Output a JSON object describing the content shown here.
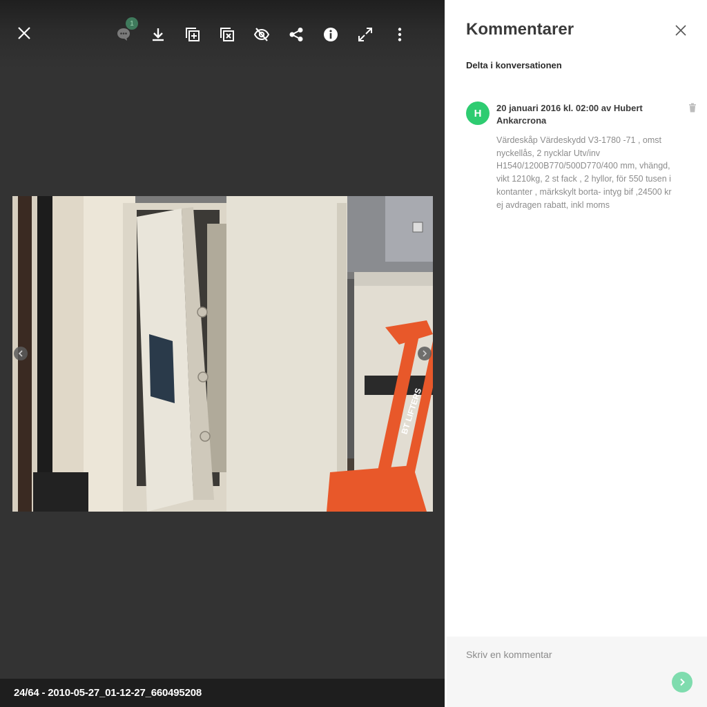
{
  "toolbar": {
    "comment_count": "1",
    "icons": [
      "close-icon",
      "comment-icon",
      "download-icon",
      "add-to-album-icon",
      "remove-from-album-icon",
      "hide-icon",
      "share-icon",
      "info-icon",
      "fullscreen-icon",
      "more-icon"
    ]
  },
  "caption": "24/64 - 2010-05-27_01-12-27_660495208",
  "panel": {
    "title": "Kommentarer",
    "subtitle": "Delta i konversationen"
  },
  "comments": [
    {
      "avatar_letter": "H",
      "header": "20 januari 2016 kl. 02:00 av Hubert Ankarcrona",
      "body": "Värdeskåp Värdeskydd V3-1780 -71 , omst nyckellås, 2 nycklar Utv/inv H1540/1200B770/500D770/400 mm, vhängd, vikt 1210kg, 2 st fack , 2 hyllor, för 550 tusen i kontanter , märkskylt borta- intyg bif ,24500 kr ej avdragen rabatt, inkl moms"
    }
  ],
  "composer": {
    "placeholder": "Skriv en kommentar"
  },
  "photo": {
    "pallet_jack_text": "BT LIFTERS"
  },
  "colors": {
    "avatar": "#2ecc71",
    "send_button": "#7fdcae",
    "viewer_bg": "#333333",
    "badge": "#3f7a5c"
  }
}
